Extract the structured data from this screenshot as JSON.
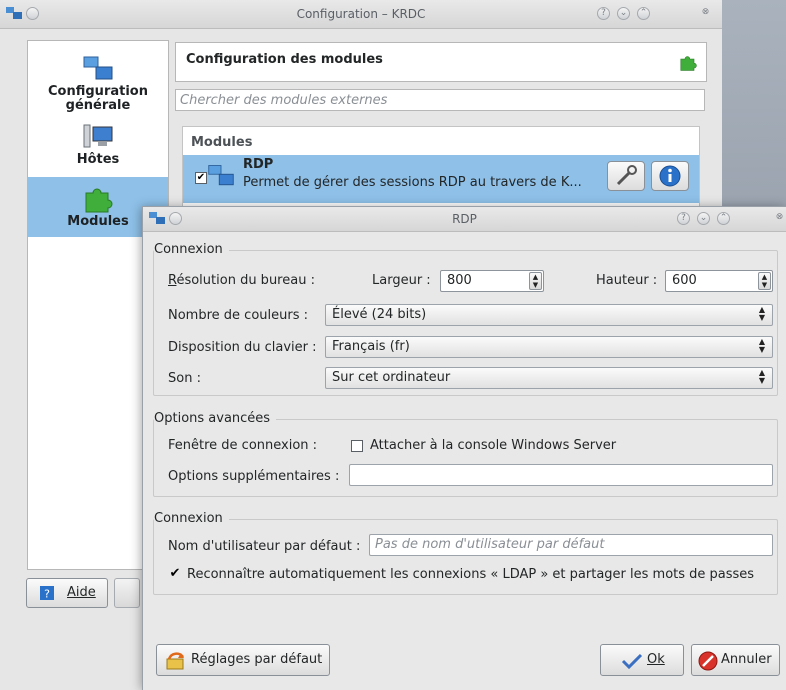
{
  "config_window": {
    "title": "Configuration – KRDC",
    "sidebar": [
      {
        "label_line1": "Configuration",
        "label_line2": "générale"
      },
      {
        "label_line1": "Hôtes",
        "label_line2": ""
      },
      {
        "label_line1": "Modules",
        "label_line2": ""
      }
    ],
    "module_header_title": "Configuration des modules",
    "search_placeholder": "Chercher des modules externes",
    "modules_title": "Modules",
    "module": {
      "name": "RDP",
      "description": "Permet de gérer des sessions RDP au travers de K...",
      "checked": true
    },
    "help_button": "Aide"
  },
  "rdp_dialog": {
    "title": "RDP",
    "connexion_group": {
      "title": "Connexion",
      "resolution_label": "Résolution du bureau :",
      "width_label": "Largeur :",
      "width_value": "800",
      "height_label": "Hauteur :",
      "height_value": "600",
      "colors_label": "Nombre de couleurs :",
      "colors_value": "Élevé (24 bits)",
      "keyboard_label": "Disposition du clavier :",
      "keyboard_value": "Français (fr)",
      "sound_label": "Son :",
      "sound_value": "Sur cet ordinateur"
    },
    "advanced_group": {
      "title": "Options avancées",
      "window_label": "Fenêtre de connexion :",
      "console_label": "Attacher à la console Windows Server",
      "console_checked": false,
      "extra_label": "Options supplémentaires :",
      "extra_value": ""
    },
    "user_group": {
      "title": "Connexion",
      "username_label": "Nom d'utilisateur par défaut :",
      "username_placeholder": "Pas de nom d'utilisateur par défaut",
      "ldap_label": "Reconnaître automatiquement les connexions « LDAP » et partager les mots de passes",
      "ldap_checked": true
    },
    "buttons": {
      "defaults": "Réglages par défaut",
      "ok": "Ok",
      "cancel": "Annuler"
    }
  },
  "colors": {
    "selection": "#8ec0e8",
    "window_bg": "#e8e8e8",
    "info_blue": "#2a72c9",
    "cancel_red": "#d8322b",
    "puzzle_green": "#3fae3a"
  }
}
